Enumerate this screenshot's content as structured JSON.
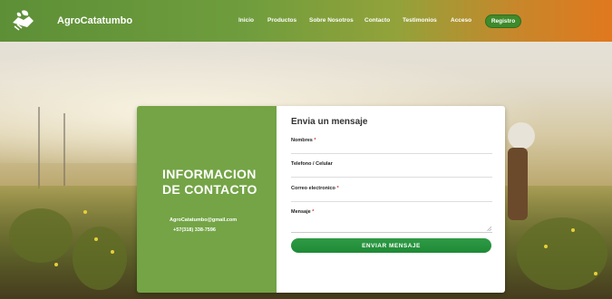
{
  "header": {
    "brand": "AgroCatatumbo",
    "nav": [
      "Inicio",
      "Productos",
      "Sobre Nosotros",
      "Contacto",
      "Testimonios",
      "Acceso"
    ],
    "register_label": "Registro"
  },
  "contact_info": {
    "title": "INFORMACION DE CONTACTO",
    "email": "AgroCatatumbo@gmail.com",
    "phone": "+57(318) 338-7596"
  },
  "form": {
    "title": "Envia un mensaje",
    "fields": [
      {
        "label": "Nombres",
        "required": "*"
      },
      {
        "label": "Telefono / Celular",
        "required": ""
      },
      {
        "label": "Correo electronico",
        "required": "*"
      },
      {
        "label": "Mensaje",
        "required": "*"
      }
    ],
    "submit_label": "ENVIAR MENSAJE"
  },
  "colors": {
    "nav_gradient_start": "#5d8f37",
    "nav_gradient_end": "#e0781e",
    "contact_panel": "#74a446",
    "submit_button": "#2f9b45",
    "required_marker": "#d23333"
  },
  "icons": {
    "logo": "handshake-leaf-icon"
  }
}
